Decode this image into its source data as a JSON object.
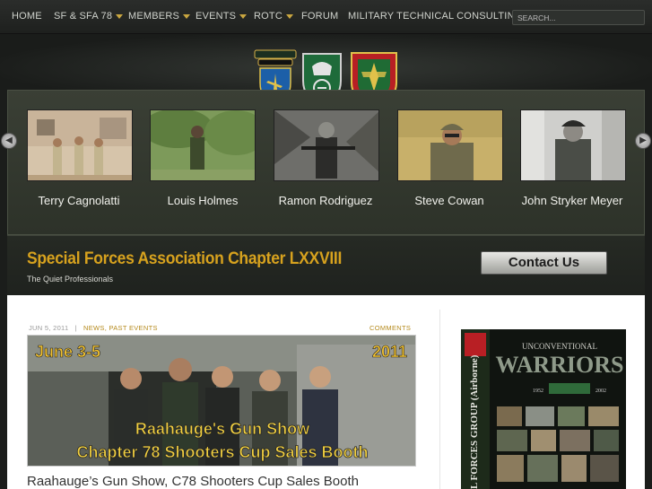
{
  "nav": {
    "items": [
      {
        "label": "HOME",
        "caret": false
      },
      {
        "label": "SF & SFA 78",
        "caret": true
      },
      {
        "label": "MEMBERS",
        "caret": true
      },
      {
        "label": "EVENTS",
        "caret": true
      },
      {
        "label": "ROTC",
        "caret": true
      },
      {
        "label": "FORUM",
        "caret": false
      },
      {
        "label": "MILITARY TECHNICAL CONSULTING",
        "caret": false
      }
    ],
    "search_placeholder": "SEARCH..."
  },
  "header": {
    "patches": [
      "special-forces-airborne-patch",
      "special-forces-50th-patch",
      "special-forces-group-crest"
    ]
  },
  "slider": {
    "members": [
      {
        "name": "Terry Cagnolatti"
      },
      {
        "name": "Louis Holmes"
      },
      {
        "name": "Ramon Rodriguez"
      },
      {
        "name": "Steve Cowan"
      },
      {
        "name": "John Stryker Meyer"
      }
    ],
    "prev_icon": "arrow-left-icon",
    "next_icon": "arrow-right-icon"
  },
  "site": {
    "title": "Special Forces Association Chapter LXXVIII",
    "tagline": "The Quiet Professionals",
    "contact_label": "Contact Us"
  },
  "post": {
    "date": "JUN 5, 2011",
    "separator": "|",
    "categories": "NEWS, PAST EVENTS",
    "comments_label": "COMMENTS",
    "image_date_left": "June 3-5",
    "image_date_right": "2011",
    "image_line1": "Raahauge's Gun Show",
    "image_line2": "Chapter 78 Shooters Cup Sales Booth",
    "title": "Raahauge’s Gun Show, C78 Shooters Cup Sales Booth"
  },
  "sidebar_ad": {
    "heading_small": "UNCONVENTIONAL",
    "heading_big": "WARRIORS",
    "year_start": "1952",
    "year_end": "2002",
    "side_text": "L FORCES GROUP (Airborne)"
  },
  "colors": {
    "accent_gold": "#d7a21e",
    "nav_bg": "#2b2d2b",
    "slider_bg": "#3a3f35"
  }
}
